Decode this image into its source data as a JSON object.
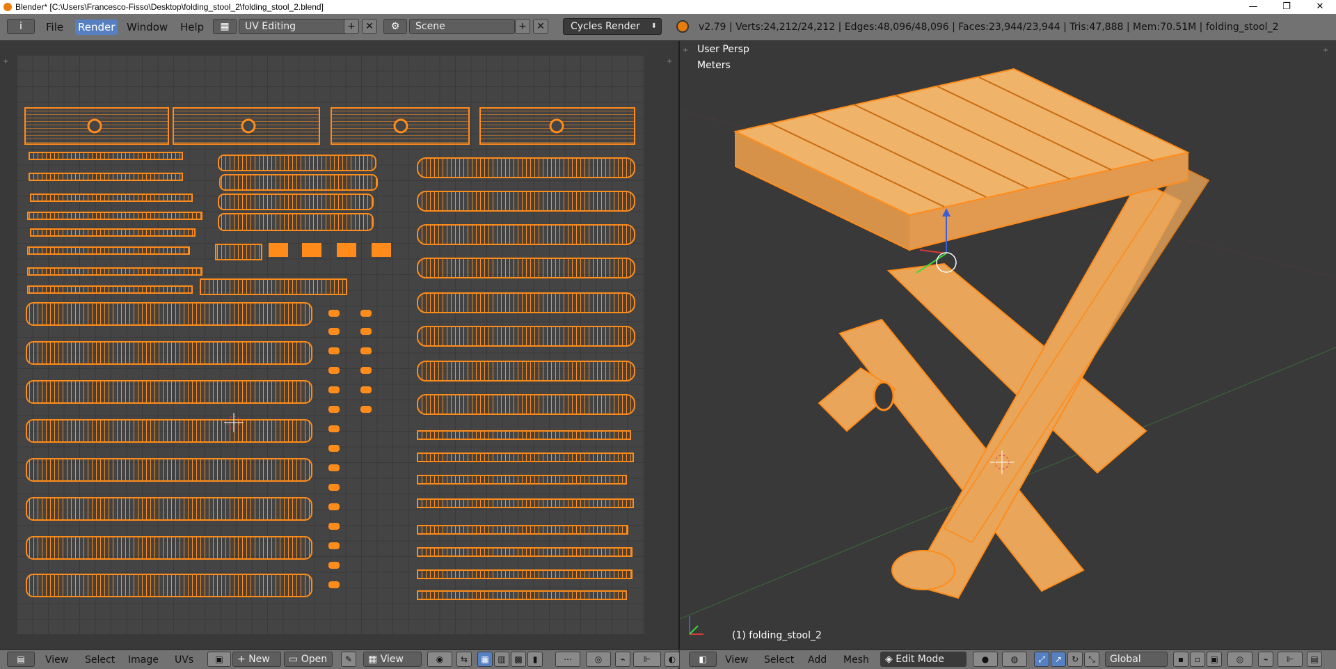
{
  "window": {
    "title": "Blender* [C:\\Users\\Francesco-Fisso\\Desktop\\folding_stool_2\\folding_stool_2.blend]",
    "minimize": "—",
    "restore": "❐",
    "close": "✕"
  },
  "info_header": {
    "editor_icon": "i",
    "menus": [
      "File",
      "Render",
      "Window",
      "Help"
    ],
    "active_menu": "Render",
    "screen_layout": "UV Editing",
    "scene": "Scene",
    "add_glyph": "+",
    "remove_glyph": "✕",
    "render_engine": "Cycles Render",
    "stats": "v2.79 | Verts:24,212/24,212 | Edges:48,096/48,096 | Faces:23,944/23,944 | Tris:47,888 | Mem:70.51M | folding_stool_2"
  },
  "viewport": {
    "view_name": "User Persp",
    "units": "Meters",
    "object_label": "(1) folding_stool_2"
  },
  "uv_footer": {
    "menus": [
      "View",
      "Select",
      "Image",
      "UVs"
    ],
    "new_label": "New",
    "open_label": "Open",
    "view_label": "View"
  },
  "view3d_footer": {
    "menus": [
      "View",
      "Select",
      "Add",
      "Mesh"
    ],
    "mode": "Edit Mode",
    "orientation": "Global"
  },
  "colors": {
    "selection": "#ff8c1a",
    "active_button": "#5680c2",
    "header": "#727272",
    "background": "#393939"
  }
}
